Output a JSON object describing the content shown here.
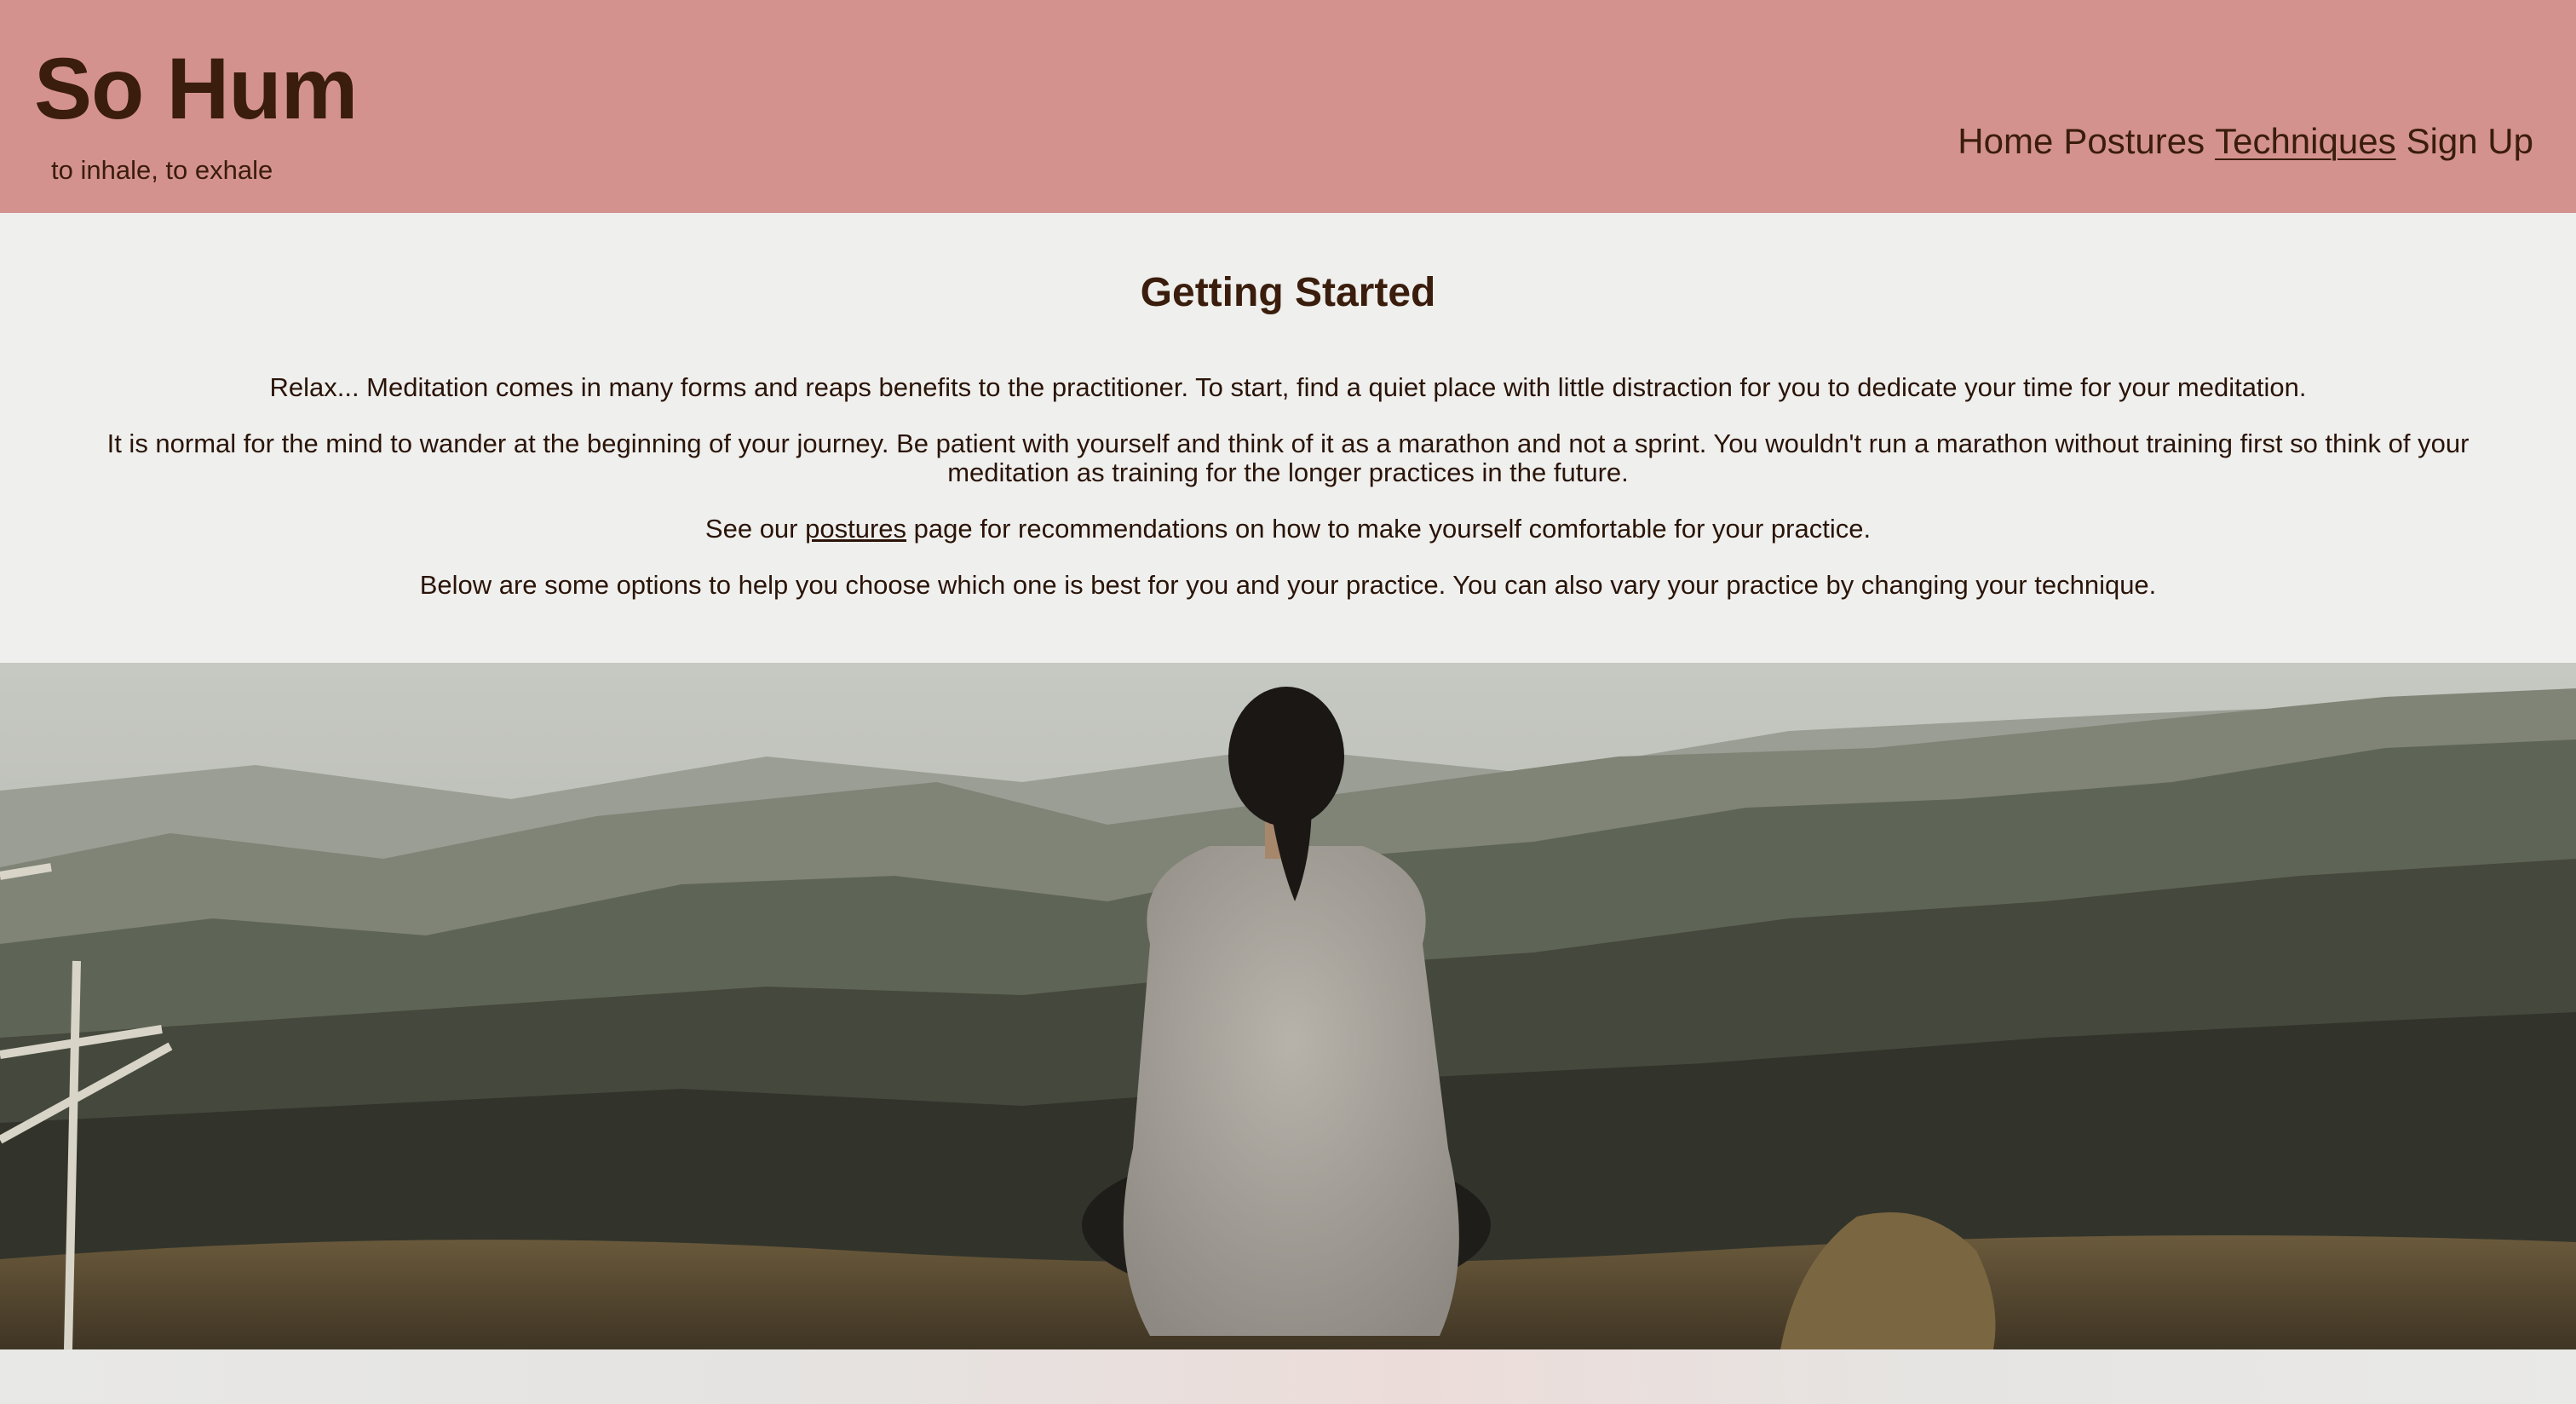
{
  "site": {
    "title": "So Hum",
    "tagline": "to inhale, to exhale"
  },
  "nav": {
    "items": [
      {
        "label": "Home"
      },
      {
        "label": "Postures"
      },
      {
        "label": "Techniques",
        "active": true
      },
      {
        "label": "Sign Up"
      }
    ]
  },
  "intro": {
    "heading": "Getting Started",
    "p1": "Relax... Meditation comes in many forms and reaps benefits to the practitioner. To start, find a quiet place with little distraction for you to dedicate your time for your meditation.",
    "p2": "It is normal for the mind to wander at the beginning of your journey. Be patient with yourself and think of it as a marathon and not a sprint. You wouldn't run a marathon without training first so think of your meditation as training for the longer practices in the future.",
    "p3_before": "See our ",
    "p3_link": "postures",
    "p3_after": " page for recommendations on how to make yourself comfortable for your practice.",
    "p4": "Below are some options to help you choose which one is best for you and your practice. You can also vary your practice by changing your technique."
  },
  "colors": {
    "header_bg": "#d4928e",
    "text": "#3a1d0c",
    "section_bg": "#efefed"
  }
}
